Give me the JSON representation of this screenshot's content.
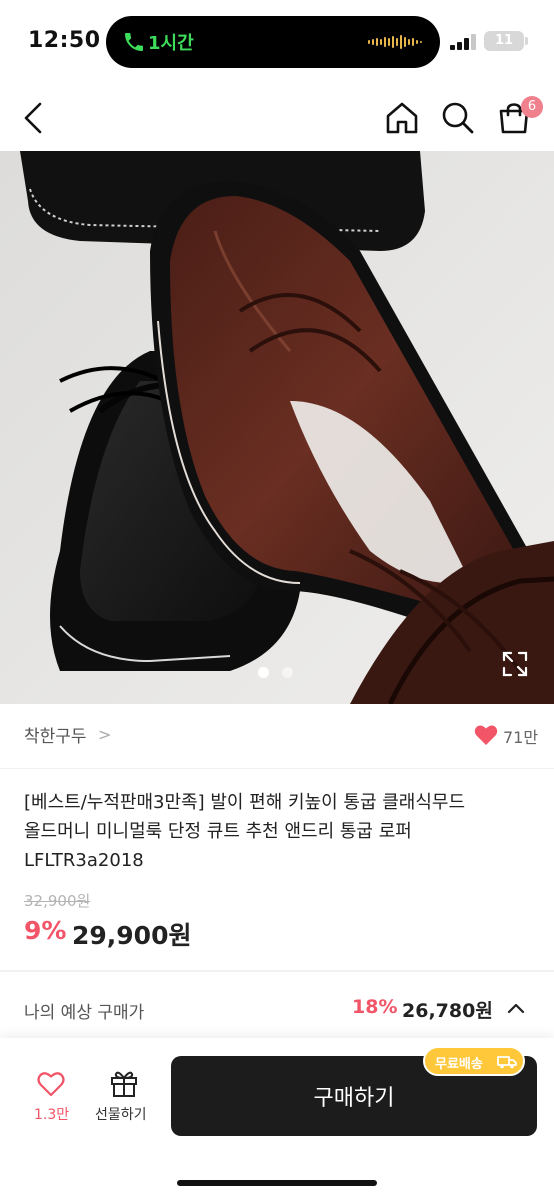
{
  "status_bar": {
    "time": "12:50",
    "call_duration": "1시간",
    "battery_level": "11"
  },
  "nav": {
    "back_icon": "chevron-left-icon",
    "home_icon": "home-icon",
    "search_icon": "search-icon",
    "cart_icon": "shopping-bag-icon",
    "cart_count": "6"
  },
  "gallery": {
    "current_index": 1,
    "total_images": 2,
    "expand_icon": "expand-icon"
  },
  "product": {
    "seller": "착한구두",
    "seller_chevron": ">",
    "like_count": "71만",
    "title_lines": [
      "[베스트/누적판매3만족] 발이 편해 키높이 통굽 클래식무드",
      "올드머니 미니멀룩 단정 큐트 추천 앤드리 통굽 로퍼",
      "LFLTR3a2018"
    ],
    "original_price": "32,900원",
    "discount_rate": "9%",
    "price": "29,900원"
  },
  "expected_price": {
    "label": "나의 예상 구매가",
    "discount_rate": "18%",
    "price": "26,780원"
  },
  "bottom_bar": {
    "wish_count": "1.3만",
    "gift_label": "선물하기",
    "buy_label": "구매하기",
    "shipping_badge": "무료배송"
  },
  "colors": {
    "accent_pink": "#f15567",
    "badge_pink": "#f0808c",
    "shipping_yellow": "#ffc83a",
    "buy_button": "#1c1c1c",
    "call_green": "#3ddc5b"
  }
}
